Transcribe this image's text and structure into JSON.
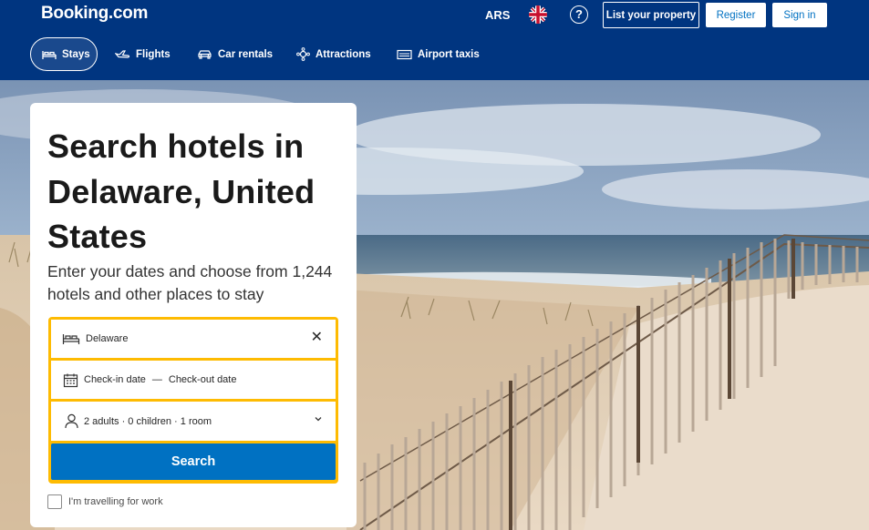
{
  "header": {
    "logo": "Booking.com",
    "currency": "ARS",
    "flag_icon": "uk-flag-icon",
    "help_symbol": "?",
    "list_property": "List your property",
    "register": "Register",
    "sign_in": "Sign in"
  },
  "nav": {
    "items": [
      {
        "label": "Stays",
        "icon": "bed-icon",
        "active": true
      },
      {
        "label": "Flights",
        "icon": "plane-icon",
        "active": false
      },
      {
        "label": "Car rentals",
        "icon": "car-icon",
        "active": false
      },
      {
        "label": "Attractions",
        "icon": "attractions-icon",
        "active": false
      },
      {
        "label": "Airport taxis",
        "icon": "taxi-icon",
        "active": false
      }
    ]
  },
  "hero": {
    "title": "Search hotels in Delaware, United States",
    "subtitle": "Enter your dates and choose from 1,244 hotels and other places to stay"
  },
  "search": {
    "destination_value": "Delaware",
    "clear_symbol": "✕",
    "checkin_label": "Check-in date",
    "date_separator": "—",
    "checkout_label": "Check-out date",
    "guests": "2 adults · 0 children · 1 room",
    "search_button": "Search",
    "work_travel_label": "I'm travelling for work"
  },
  "colors": {
    "brand_blue": "#003580",
    "accent_yellow": "#febb02",
    "button_blue": "#0071c2"
  }
}
